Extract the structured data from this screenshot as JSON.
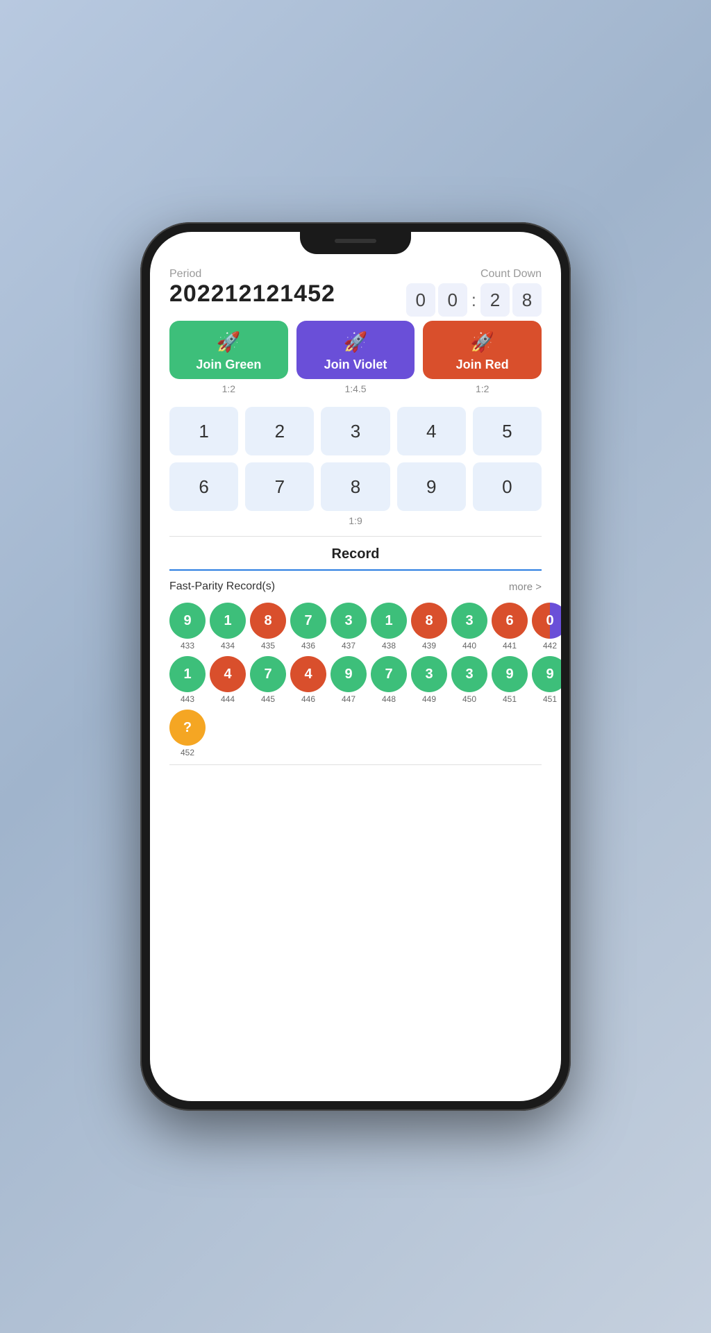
{
  "header": {
    "period_label": "Period",
    "countdown_label": "Count Down",
    "period_value": "202212121452",
    "countdown": [
      "0",
      "0",
      "2",
      "8"
    ]
  },
  "join_buttons": [
    {
      "id": "green",
      "label": "Join Green",
      "sub": "1:2",
      "color_class": "btn-green"
    },
    {
      "id": "violet",
      "label": "Join Violet",
      "sub": "1:4.5",
      "color_class": "btn-violet"
    },
    {
      "id": "red",
      "label": "Join Red",
      "sub": "1:2",
      "color_class": "btn-red"
    }
  ],
  "number_grid": {
    "row1": [
      "1",
      "2",
      "3",
      "4",
      "5"
    ],
    "row2": [
      "6",
      "7",
      "8",
      "9",
      "0"
    ],
    "sub": "1:9"
  },
  "record": {
    "title": "Record",
    "fast_parity_label": "Fast-Parity Record(s)",
    "more_label": "more >",
    "rows": [
      {
        "balls": [
          {
            "num": "9",
            "color": "green",
            "id": "433"
          },
          {
            "num": "1",
            "color": "green",
            "id": "434"
          },
          {
            "num": "8",
            "color": "red",
            "id": "435"
          },
          {
            "num": "7",
            "color": "green",
            "id": "436"
          },
          {
            "num": "3",
            "color": "green",
            "id": "437"
          },
          {
            "num": "1",
            "color": "green",
            "id": "438"
          },
          {
            "num": "8",
            "color": "red",
            "id": "439"
          },
          {
            "num": "3",
            "color": "green",
            "id": "440"
          },
          {
            "num": "6",
            "color": "red",
            "id": "441"
          },
          {
            "num": "0",
            "color": "half",
            "id": "442"
          }
        ]
      },
      {
        "balls": [
          {
            "num": "1",
            "color": "green",
            "id": "443"
          },
          {
            "num": "4",
            "color": "red",
            "id": "444"
          },
          {
            "num": "7",
            "color": "green",
            "id": "445"
          },
          {
            "num": "4",
            "color": "red",
            "id": "446"
          },
          {
            "num": "9",
            "color": "green",
            "id": "447"
          },
          {
            "num": "7",
            "color": "green",
            "id": "448"
          },
          {
            "num": "3",
            "color": "green",
            "id": "449"
          },
          {
            "num": "3",
            "color": "green",
            "id": "450"
          },
          {
            "num": "9",
            "color": "green",
            "id": "451"
          },
          {
            "num": "9",
            "color": "green",
            "id": "451b"
          }
        ]
      },
      {
        "balls": [
          {
            "num": "?",
            "color": "orange",
            "id": "452"
          }
        ]
      }
    ]
  }
}
